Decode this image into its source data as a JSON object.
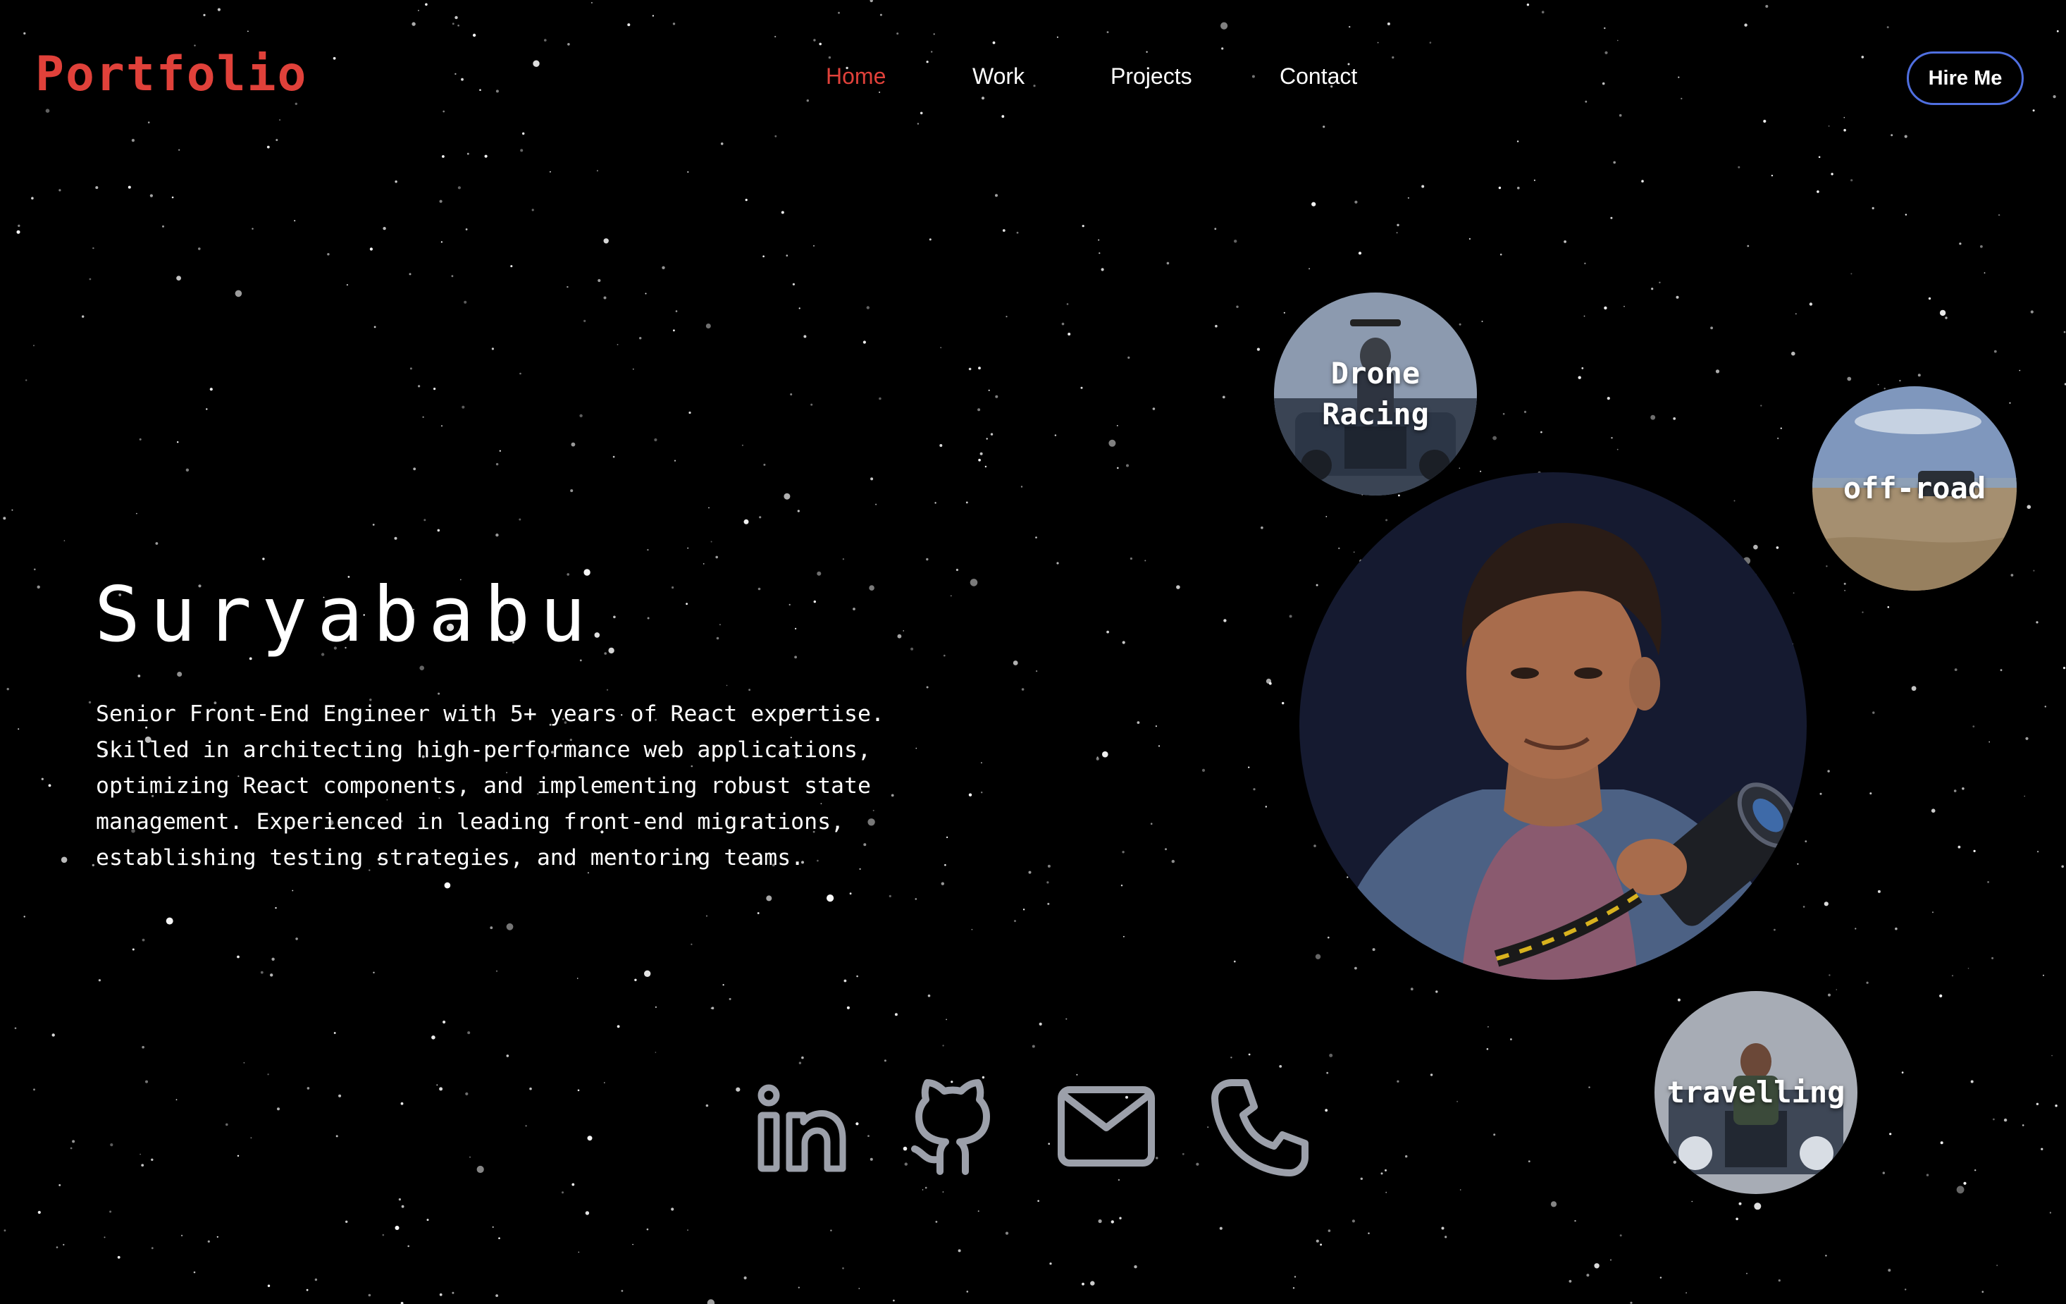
{
  "header": {
    "logo": "Portfolio",
    "nav": [
      {
        "label": "Home",
        "active": true
      },
      {
        "label": "Work",
        "active": false
      },
      {
        "label": "Projects",
        "active": false
      },
      {
        "label": "Contact",
        "active": false
      }
    ],
    "cta_label": "Hire Me"
  },
  "hero": {
    "name": "Suryababu",
    "description_lines": [
      "Senior Front-End Engineer with 5+ years of React expertise.",
      "Skilled in architecting high-performance web applications,",
      "optimizing React components, and implementing robust state",
      "management. Experienced in leading front-end migrations,",
      "establishing testing strategies, and mentoring teams."
    ]
  },
  "interests": [
    {
      "label_lines": [
        "Drone",
        "Racing"
      ],
      "icon": "drone-racing-photo"
    },
    {
      "label_lines": [
        "off-road"
      ],
      "icon": "off-road-photo"
    },
    {
      "label_lines": [
        "travelling"
      ],
      "icon": "travelling-photo"
    }
  ],
  "profile_photo": {
    "icon": "profile-portrait-photo"
  },
  "social": [
    {
      "icon": "linkedin-icon"
    },
    {
      "icon": "github-icon"
    },
    {
      "icon": "mail-icon"
    },
    {
      "icon": "phone-icon"
    }
  ],
  "colors": {
    "accent": "#e0413a",
    "button_border": "#4f6fe0",
    "background": "#000000",
    "icon": "#9ca0aa",
    "text": "#ffffff"
  }
}
